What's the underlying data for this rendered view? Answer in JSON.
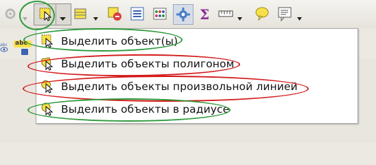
{
  "toolbar": {
    "buttons": [
      {
        "name": "identify-icon",
        "interactable": true
      },
      {
        "name": "select-feature-icon",
        "interactable": true
      },
      {
        "name": "attribute-table-icon",
        "interactable": true
      },
      {
        "name": "deselect-icon",
        "interactable": true
      },
      {
        "name": "open-table-icon",
        "interactable": true
      },
      {
        "name": "field-calculator-icon",
        "interactable": true
      },
      {
        "name": "toolbox-gear-icon",
        "interactable": true
      },
      {
        "name": "statistics-sigma-icon",
        "interactable": true
      },
      {
        "name": "measure-ruler-icon",
        "interactable": true
      },
      {
        "name": "map-tips-icon",
        "interactable": true
      },
      {
        "name": "annotation-icon",
        "interactable": true
      }
    ]
  },
  "label_tool_text": "abc",
  "menu": {
    "items": [
      {
        "label": "Выделить объект(ы)",
        "highlight": "#2e9a3a"
      },
      {
        "label": "Выделить объекты полигоном",
        "highlight": "#d41a1a"
      },
      {
        "label": "Выделить объекты произвольной линией",
        "highlight": "#d41a1a"
      },
      {
        "label": "Выделить объекты в радиусе",
        "highlight": "#2e9a3a"
      }
    ]
  },
  "colors": {
    "highlight_green": "#2e9a3a",
    "highlight_red": "#d41a1a",
    "selection_yellow": "#f7e14a"
  }
}
